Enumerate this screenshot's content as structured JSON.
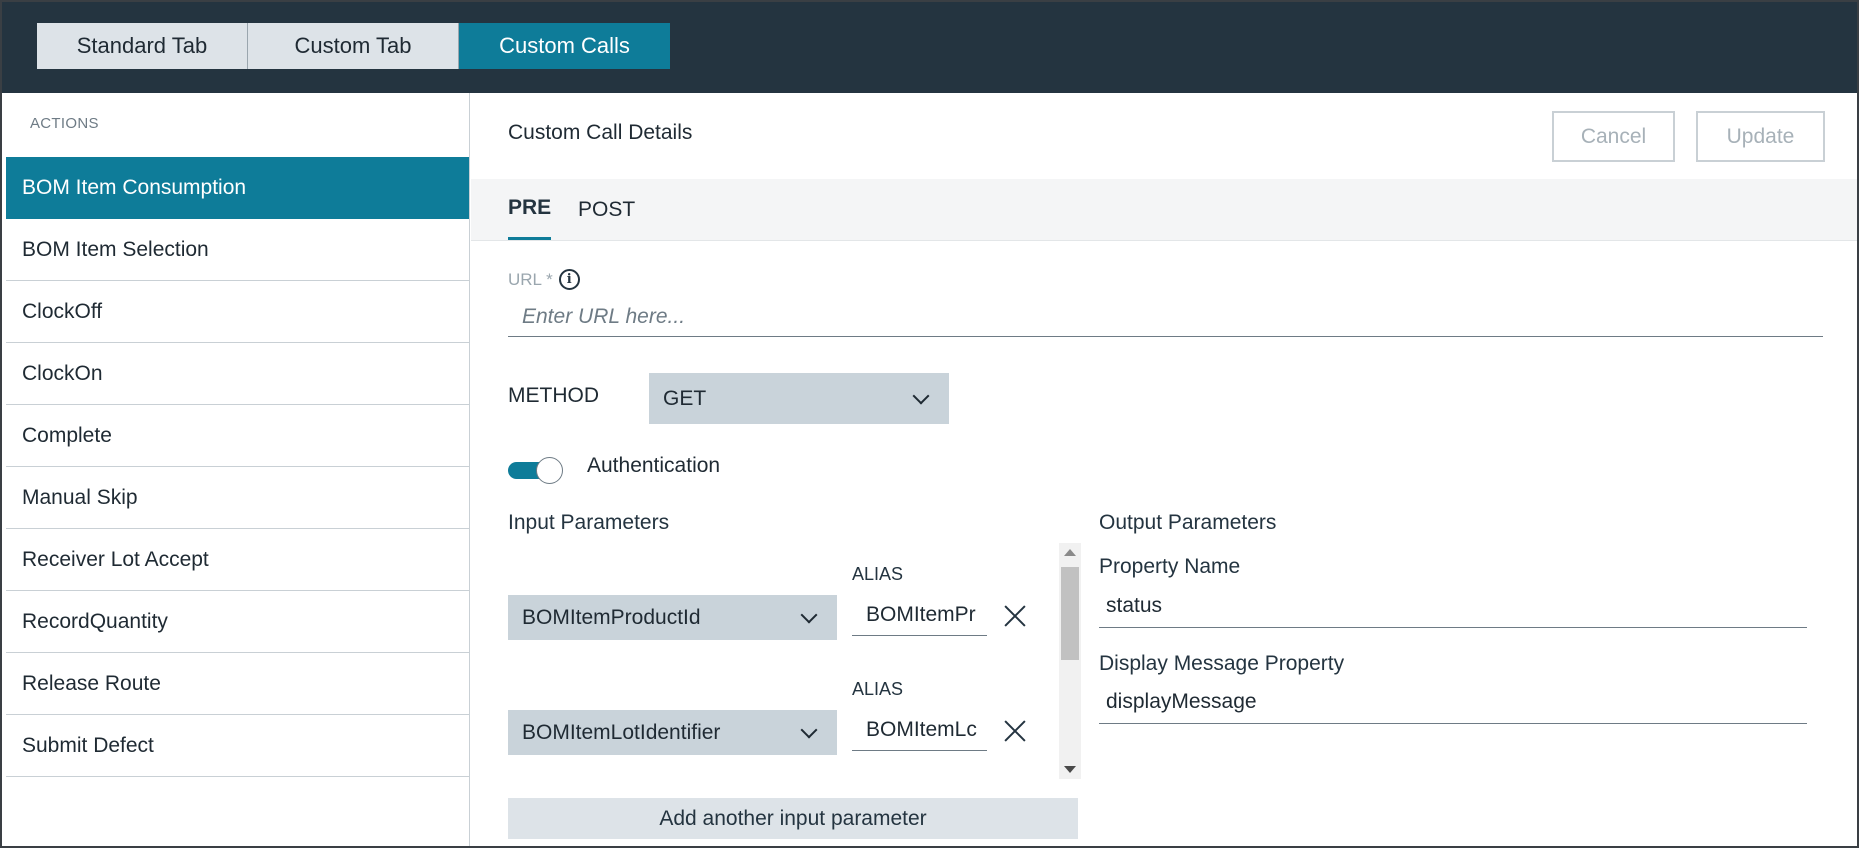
{
  "top_tabs": [
    {
      "label": "Standard Tab",
      "active": false
    },
    {
      "label": "Custom Tab",
      "active": false
    },
    {
      "label": "Custom Calls",
      "active": true
    }
  ],
  "sidebar": {
    "heading": "ACTIONS",
    "items": [
      {
        "label": "BOM Item Consumption",
        "active": true
      },
      {
        "label": "BOM Item Selection"
      },
      {
        "label": "ClockOff"
      },
      {
        "label": "ClockOn"
      },
      {
        "label": "Complete"
      },
      {
        "label": "Manual Skip"
      },
      {
        "label": "Receiver Lot Accept"
      },
      {
        "label": "RecordQuantity"
      },
      {
        "label": "Release Route"
      },
      {
        "label": "Submit Defect"
      }
    ]
  },
  "details": {
    "title": "Custom Call Details",
    "cancel_label": "Cancel",
    "update_label": "Update",
    "tabs": [
      {
        "label": "PRE",
        "active": true
      },
      {
        "label": "POST",
        "active": false
      }
    ],
    "url": {
      "label": "URL *",
      "placeholder": "Enter URL here...",
      "value": ""
    },
    "method": {
      "label": "METHOD",
      "value": "GET"
    },
    "authentication": {
      "label": "Authentication",
      "enabled": true
    },
    "input_parameters": {
      "title": "Input Parameters",
      "params": [
        {
          "name": "BOMItemProductId",
          "alias_label": "ALIAS",
          "alias_value": "BOMItemPr"
        },
        {
          "name": "BOMItemLotIdentifier",
          "alias_label": "ALIAS",
          "alias_value": "BOMItemLc"
        }
      ],
      "add_label": "Add another input parameter"
    },
    "output_parameters": {
      "title": "Output Parameters",
      "property_name_label": "Property Name",
      "property_name_value": "status",
      "display_message_label": "Display Message Property",
      "display_message_value": "displayMessage"
    }
  },
  "colors": {
    "accent": "#0e7c99",
    "topbar": "#243440",
    "select_bg": "#c9d3da"
  }
}
